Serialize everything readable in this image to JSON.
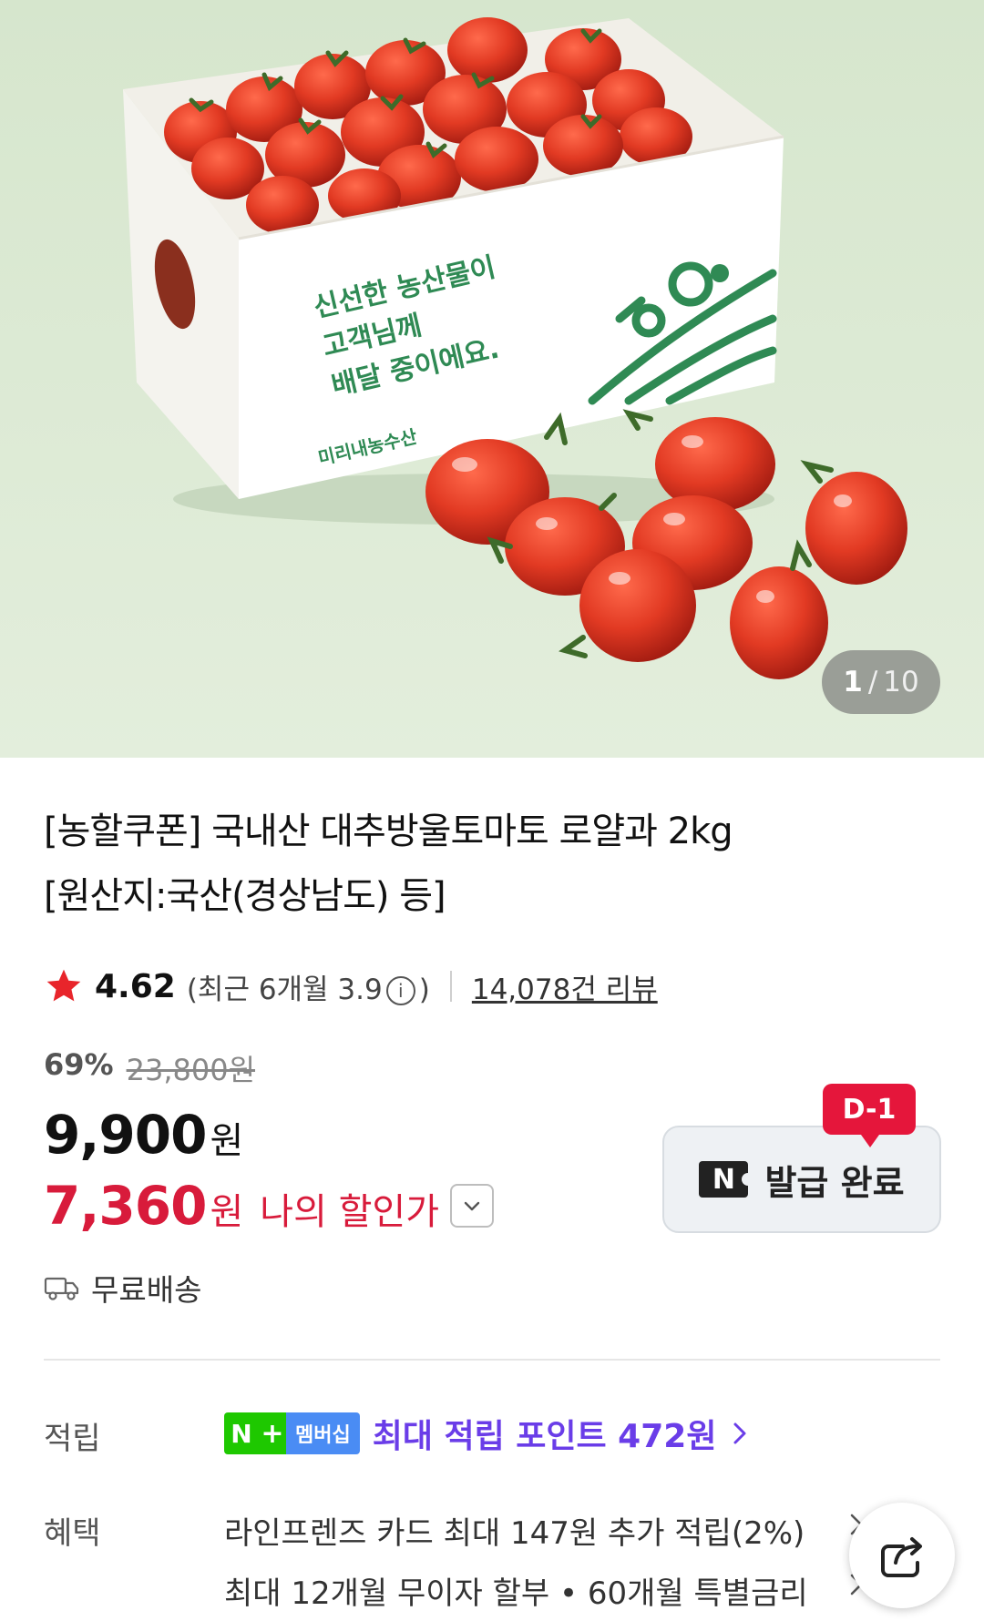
{
  "hero": {
    "box_text_lines": [
      "신선한 농산물이",
      "고객님께",
      "배달 중이에요."
    ],
    "box_brand": "미리내농수산",
    "counter_current": "1",
    "counter_separator": "/",
    "counter_total": "10"
  },
  "product": {
    "title_line1": "[농할쿠폰] 국내산 대추방울토마토 로얄과 2kg",
    "title_line2": "[원산지:국산(경상남도) 등]",
    "rating": "4.62",
    "recent_rating_prefix": "(최근 6개월 3.9",
    "recent_rating_suffix": ")",
    "info_icon_glyph": "i",
    "reviews": "14,078건 리뷰",
    "discount_rate": "69%",
    "original_price": "23,800원",
    "price": "9,900",
    "price_unit": "원",
    "my_price": "7,360",
    "my_price_unit": "원",
    "my_price_label": "나의 할인가"
  },
  "coupon": {
    "dday": "D-1",
    "logo_letter": "N",
    "label": "발급 완료"
  },
  "shipping": {
    "label": "무료배송"
  },
  "points": {
    "label": "적립",
    "badge_n": "N",
    "badge_plus": "+",
    "badge_membership": "멤버십",
    "text": "최대 적립 포인트 472원"
  },
  "benefits": {
    "label": "혜택",
    "line1": "라인프렌즈 카드 최대 147원 추가 적립(2%)",
    "line2": "최대 12개월 무이자 할부 • 60개월 특별금리"
  },
  "colors": {
    "accent_red": "#d81b3b",
    "points_purple": "#6a3de8",
    "naver_green": "#1ec800",
    "hero_bg": "#dbe9d3"
  },
  "icons": {
    "star": "star-icon",
    "truck": "truck-icon",
    "chevron_down": "chevron-down-icon",
    "chevron_right": "chevron-right-icon",
    "share": "share-icon"
  }
}
